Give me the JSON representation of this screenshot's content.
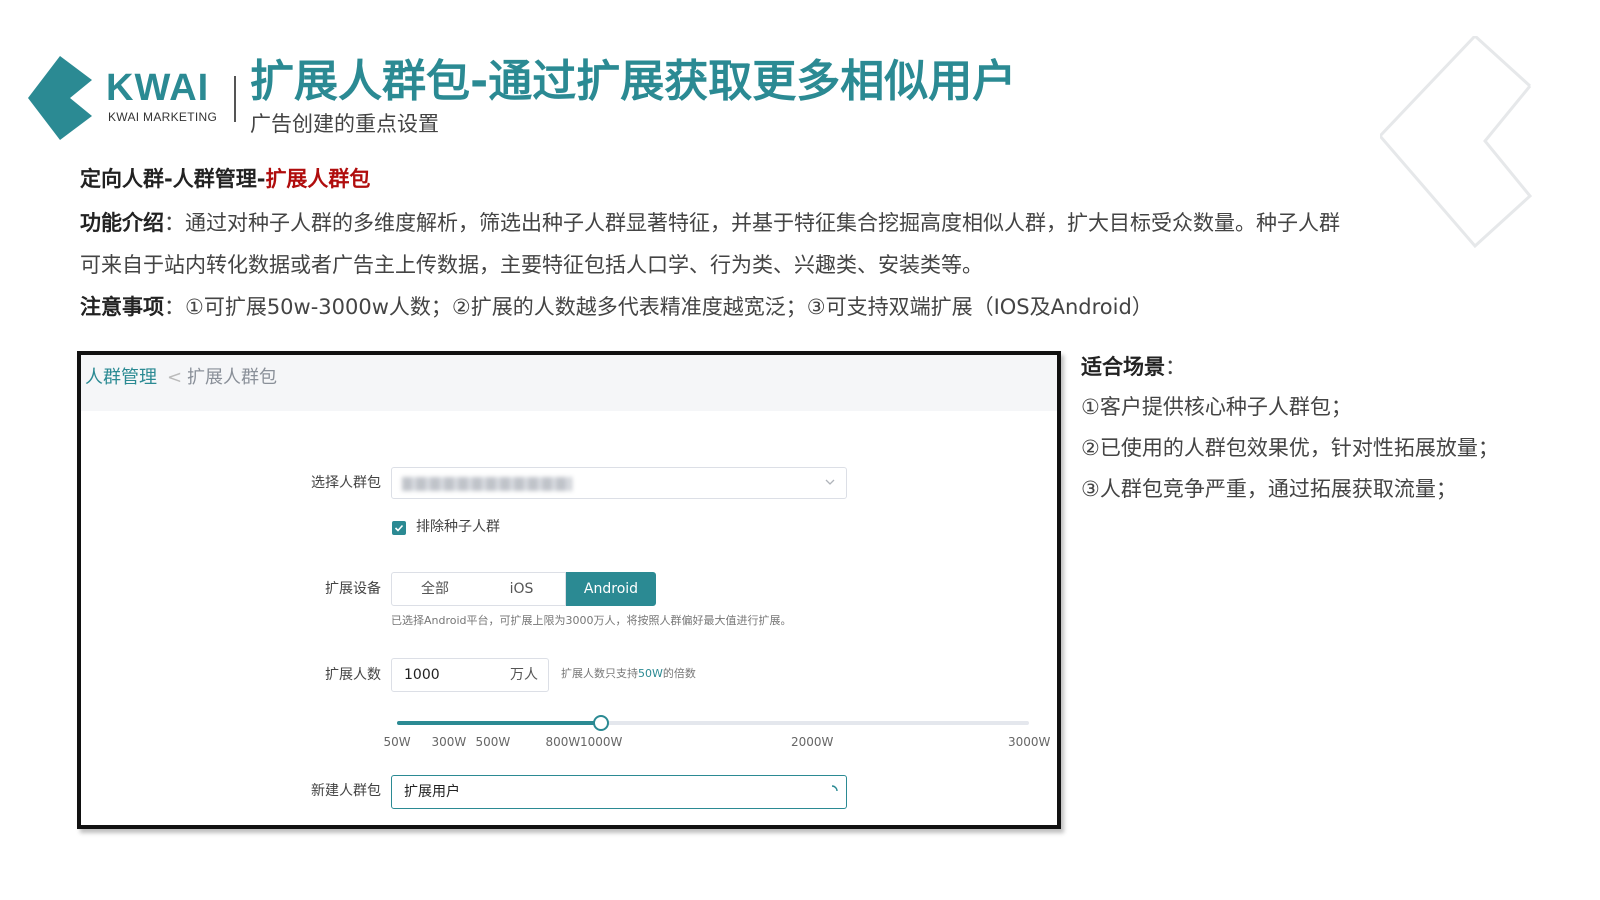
{
  "brand": {
    "logo_text": "KWAI",
    "logo_sub": "KWAI MARKETING",
    "accent_color": "#2b8a93",
    "highlight_color": "#b00d0d"
  },
  "header": {
    "title": "扩展人群包-通过扩展获取更多相似用户",
    "subtitle": "广告创建的重点设置"
  },
  "section": {
    "heading_prefix": "定向人群-人群管理-",
    "heading_highlight": "扩展人群包",
    "intro_label": "功能介绍",
    "intro_line1": "：通过对种子人群的多维度解析，筛选出种子人群显著特征，并基于特征集合挖掘高度相似人群，扩大目标受众数量。种子人群",
    "intro_line2": "可来自于站内转化数据或者广告主上传数据，主要特征包括人口学、行为类、兴趣类、安装类等。",
    "notes_label": "注意事项",
    "notes_text": "：①可扩展50w-3000w人数；②扩展的人数越多代表精准度越宽泛；③可支持双端扩展（IOS及Android）"
  },
  "panel": {
    "breadcrumb": {
      "link": "人群管理",
      "separator": "<",
      "current": "扩展人群包"
    },
    "select_label": "选择人群包",
    "exclude_label": "排除种子人群",
    "exclude_checked": true,
    "device_label": "扩展设备",
    "device_options": [
      "全部",
      "iOS",
      "Android"
    ],
    "device_selected": "Android",
    "device_hint": "已选择Android平台，可扩展上限为3000万人，将按照人群偏好最大值进行扩展。",
    "count_label": "扩展人数",
    "count_value": "1000",
    "count_unit": "万人",
    "count_hint_prefix": "扩展人数只支持",
    "count_hint_highlight": "50W",
    "count_hint_suffix": "的倍数",
    "slider": {
      "min": 50,
      "max": 3000,
      "value": 1000,
      "ticks": [
        50,
        300,
        500,
        800,
        1000,
        2000,
        3000
      ],
      "tick_labels": [
        "50W",
        "300W",
        "500W",
        "800W",
        "1000W",
        "2000W",
        "3000W"
      ]
    },
    "new_label": "新建人群包",
    "new_value": "扩展用户"
  },
  "side": {
    "heading": "适合场景",
    "heading_colon": "：",
    "items": [
      "①客户提供核心种子人群包；",
      "②已使用的人群包效果优，针对性拓展放量；",
      "③人群包竞争严重，通过拓展获取流量；"
    ]
  },
  "icons": {
    "logo": "kwai-logo-icon",
    "chevron": "chevron-down-icon",
    "check": "check-icon",
    "spinner": "loading-spinner-icon",
    "decoration": "outline-chevron-decoration-icon"
  }
}
